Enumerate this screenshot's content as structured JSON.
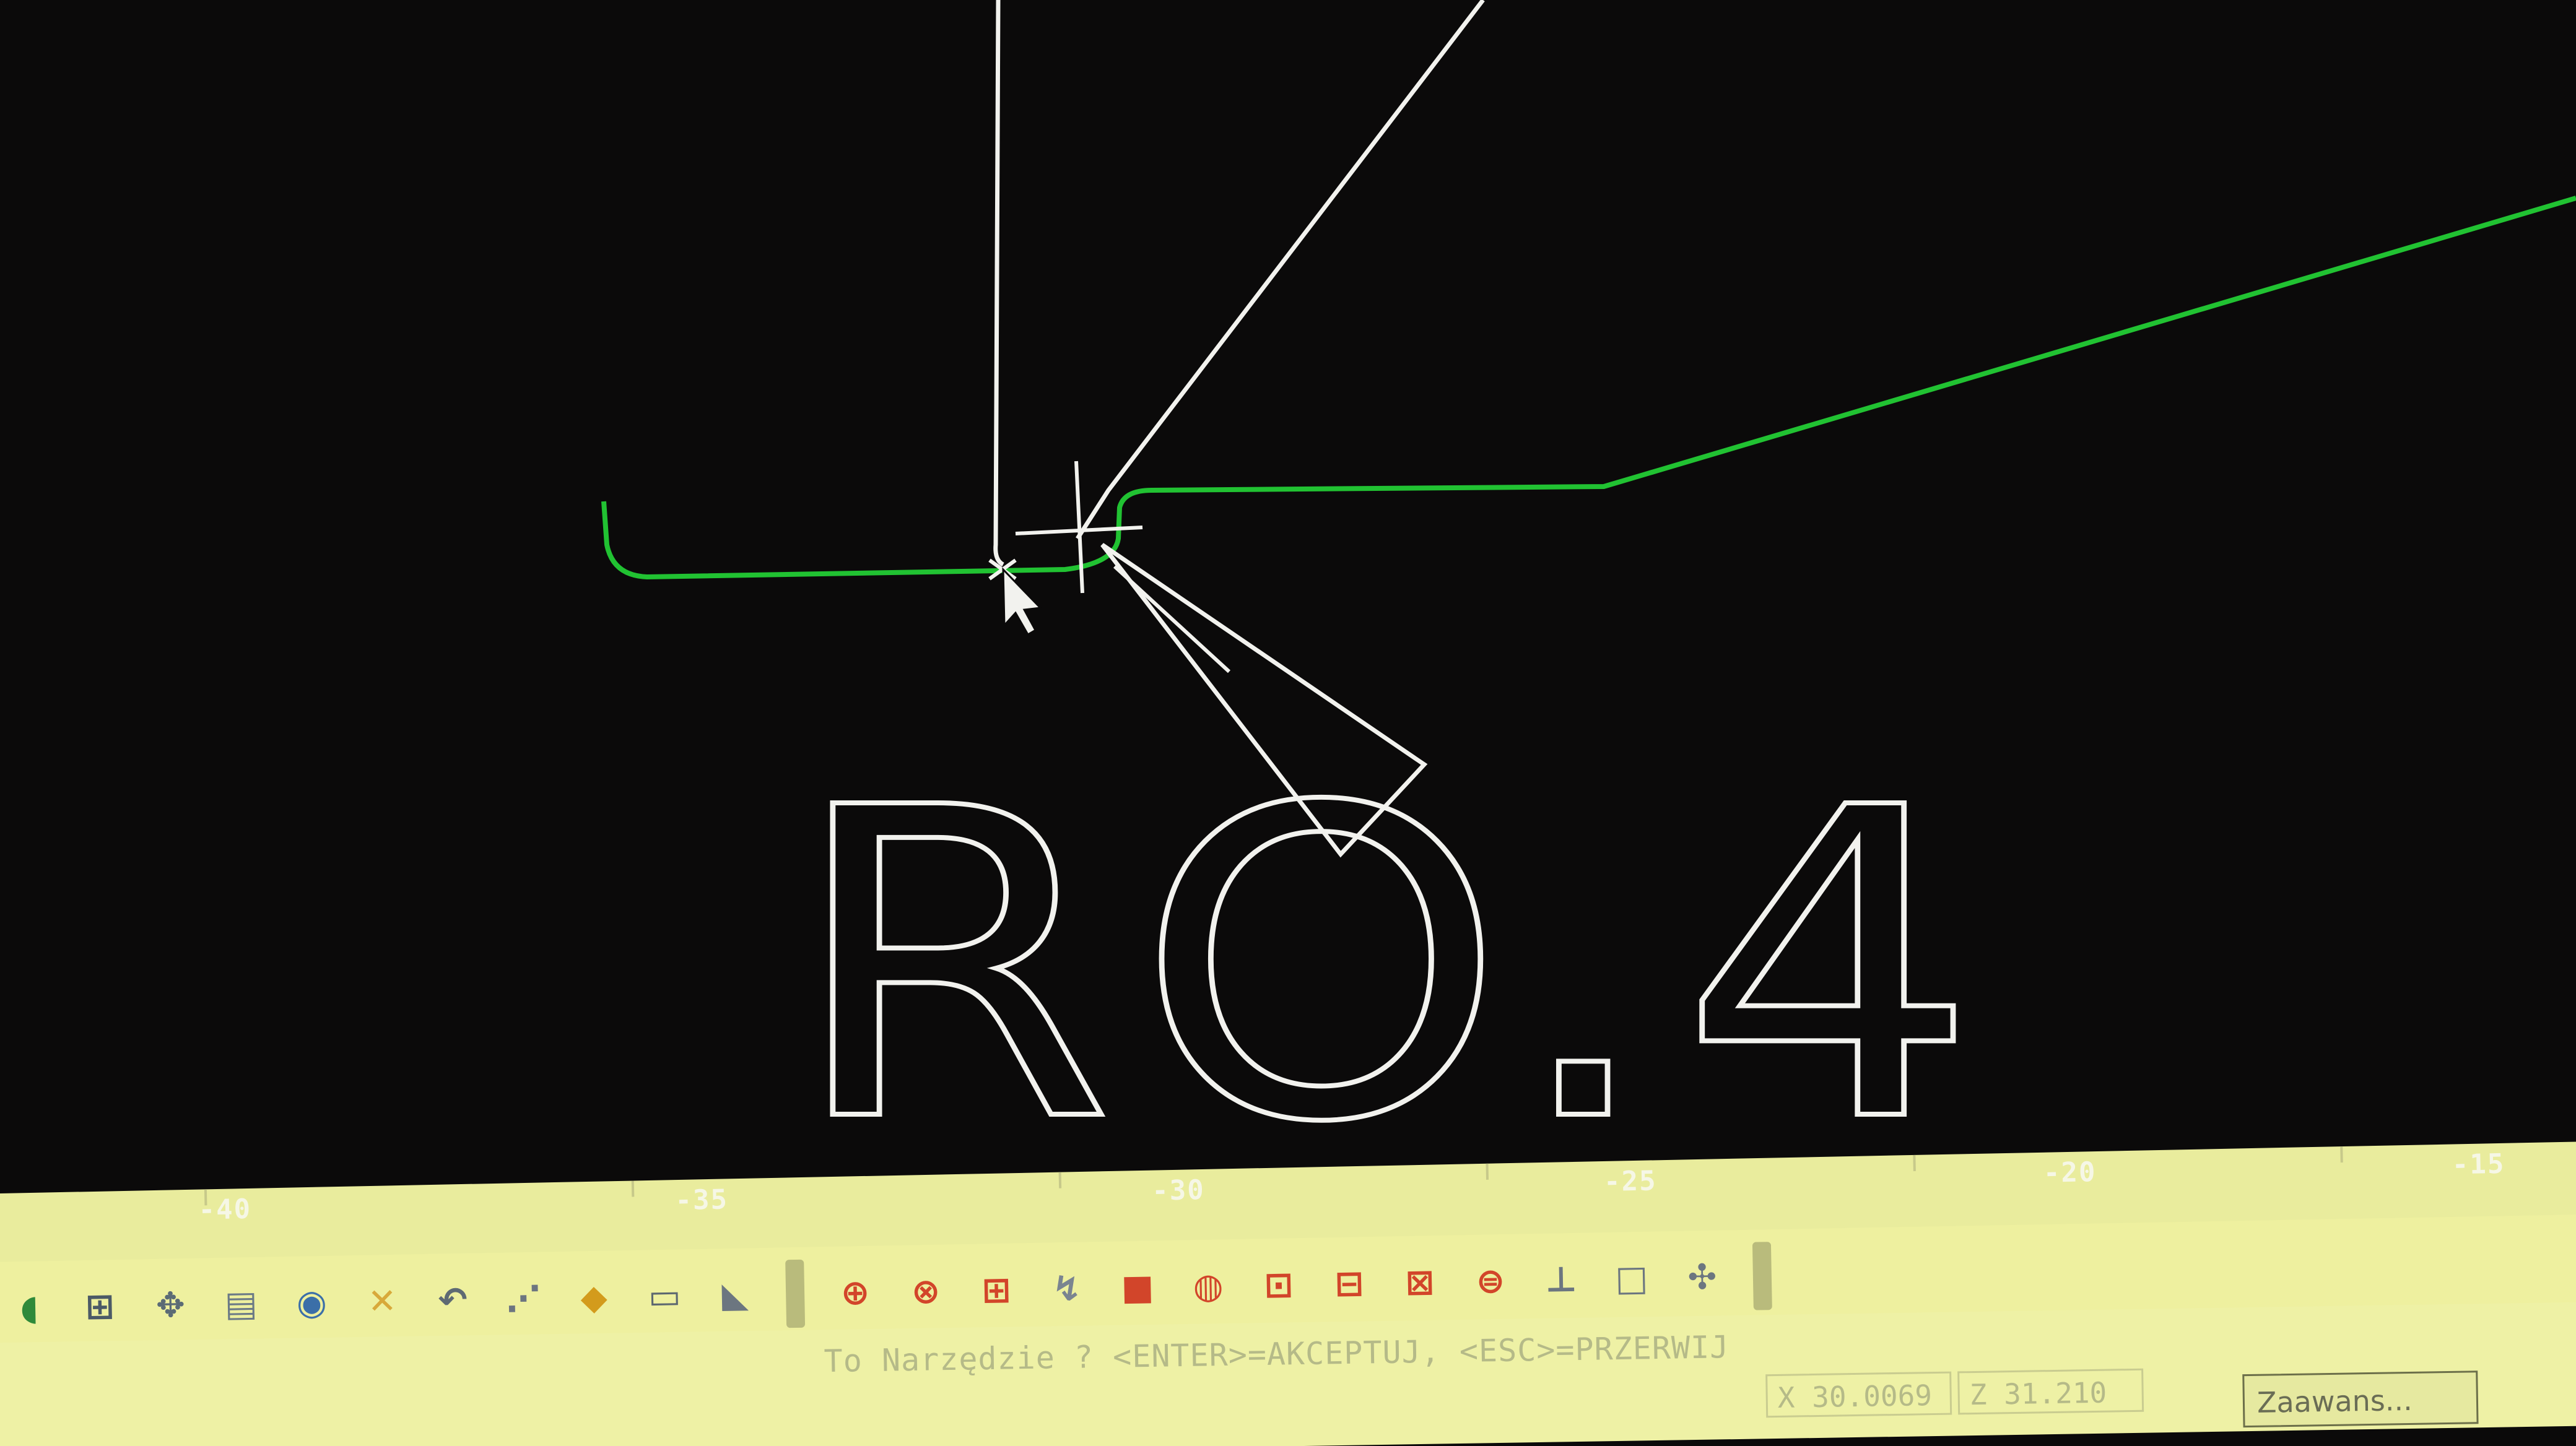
{
  "drawing": {
    "label_text": "RO.4",
    "colors": {
      "background": "#0b0a0a",
      "geometry": "#f2f2ee",
      "toolpath": "#21c232",
      "underline": "#d8d47a"
    }
  },
  "ruler": {
    "labels": [
      "-40",
      "-35",
      "-30",
      "-25",
      "-20",
      "-15"
    ]
  },
  "toolbar": {
    "buttons": [
      {
        "name": "toolbar-button-1-icon",
        "glyph": "◖",
        "color": "#2f8a3a"
      },
      {
        "name": "toolbar-button-2-icon",
        "glyph": "⊞",
        "color": "#4c5a66"
      },
      {
        "name": "toolbar-button-3-icon",
        "glyph": "✥",
        "color": "#5b6b75"
      },
      {
        "name": "toolbar-button-4-icon",
        "glyph": "▤",
        "color": "#6b7a86"
      },
      {
        "name": "toolbar-button-5-icon",
        "glyph": "◉",
        "color": "#3b6fa8"
      },
      {
        "name": "toolbar-button-6-icon",
        "glyph": "✕",
        "color": "#d8a93a"
      },
      {
        "name": "toolbar-button-7-icon",
        "glyph": "↶",
        "color": "#5e6a73"
      },
      {
        "name": "toolbar-button-8-icon",
        "glyph": "⋰",
        "color": "#6c7580"
      },
      {
        "name": "toolbar-button-9-icon",
        "glyph": "◆",
        "color": "#d39b1c"
      },
      {
        "name": "toolbar-button-10-icon",
        "glyph": "▭",
        "color": "#5d6870"
      },
      {
        "name": "toolbar-button-11-icon",
        "glyph": "◣",
        "color": "#6c7680"
      },
      {
        "name": "toolbar-button-12-icon",
        "glyph": "⊕",
        "color": "#d2452a"
      },
      {
        "name": "toolbar-button-13-icon",
        "glyph": "⊗",
        "color": "#d2452a"
      },
      {
        "name": "toolbar-button-14-icon",
        "glyph": "⊞",
        "color": "#d2452a"
      },
      {
        "name": "toolbar-button-15-icon",
        "glyph": "↯",
        "color": "#7a8490"
      },
      {
        "name": "toolbar-button-16-icon",
        "glyph": "■",
        "color": "#d2452a"
      },
      {
        "name": "toolbar-button-17-icon",
        "glyph": "◍",
        "color": "#d2452a"
      },
      {
        "name": "toolbar-button-18-icon",
        "glyph": "⊡",
        "color": "#d2452a"
      },
      {
        "name": "toolbar-button-19-icon",
        "glyph": "⊟",
        "color": "#d2452a"
      },
      {
        "name": "toolbar-button-20-icon",
        "glyph": "⊠",
        "color": "#d2452a"
      },
      {
        "name": "toolbar-button-21-icon",
        "glyph": "⊜",
        "color": "#d2452a"
      },
      {
        "name": "toolbar-button-22-icon",
        "glyph": "⊥",
        "color": "#6c7680"
      },
      {
        "name": "toolbar-button-23-icon",
        "glyph": "□",
        "color": "#6c7680"
      },
      {
        "name": "toolbar-button-24-icon",
        "glyph": "✣",
        "color": "#6c7680"
      }
    ]
  },
  "status": {
    "prompt": "To Narzędzie ? <ENTER>=AKCEPTUJ, <ESC>=PRZERWIJ",
    "x_coord": "X 30.0069",
    "z_coord": "Z 31.210",
    "mode": "Zaawans..."
  }
}
